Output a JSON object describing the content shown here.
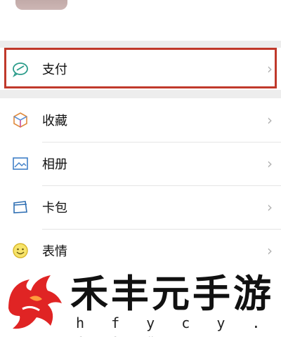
{
  "menu": {
    "pay": {
      "label": "支付",
      "icon": "wallet-icon"
    },
    "items": [
      {
        "label": "收藏",
        "icon": "favorites-cube-icon"
      },
      {
        "label": "相册",
        "icon": "album-picture-icon"
      },
      {
        "label": "卡包",
        "icon": "card-wallet-icon"
      },
      {
        "label": "表情",
        "icon": "smiley-icon"
      }
    ],
    "chevron": "›"
  },
  "highlight_color": "#c0392b",
  "watermark": {
    "title": "禾丰元手游",
    "url": "h f y c y . c o m"
  }
}
